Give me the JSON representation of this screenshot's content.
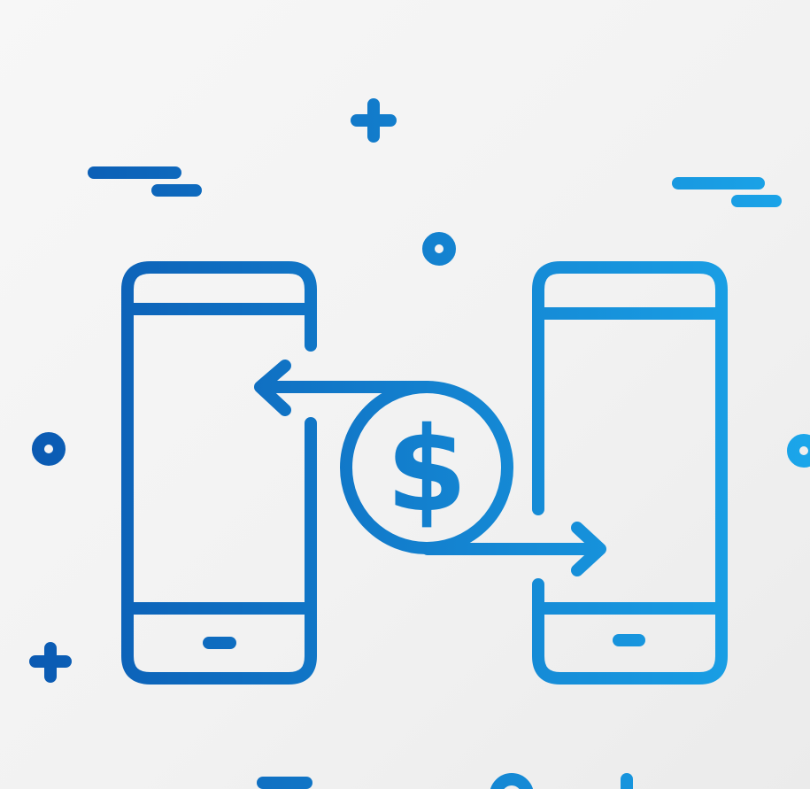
{
  "illustration": {
    "symbol": "$",
    "colors": {
      "gradient_start": "#0a57b0",
      "gradient_end": "#1ba6ea",
      "background": "#f3f3f3"
    },
    "icons": [
      "sender-phone-icon",
      "receiver-phone-icon",
      "dollar-coin-icon",
      "arrow-left-icon",
      "arrow-right-icon",
      "plus-icon",
      "circle-icon",
      "dash-lines-icon"
    ]
  }
}
